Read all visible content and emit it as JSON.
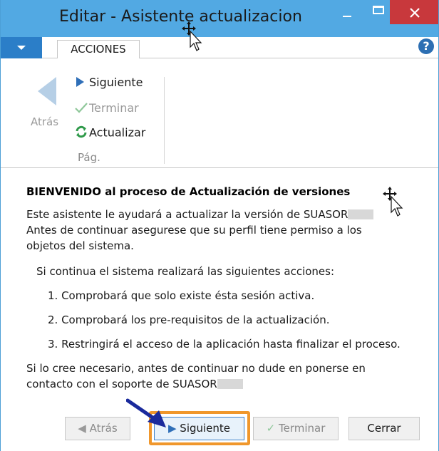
{
  "window": {
    "title": "Editar - Asistente actualizacion"
  },
  "ribbon": {
    "tab_label": "ACCIONES",
    "back_label": "Atrás",
    "next_label": "Siguiente",
    "finish_label": "Terminar",
    "refresh_label": "Actualizar",
    "group_label": "Pág."
  },
  "content": {
    "heading": "BIENVENIDO al proceso de Actualización de versiones",
    "intro_line1": "Este asistente le ayudará a actualizar la versión de SUASOR",
    "intro_line2": "Antes de continuar asegurese que su perfil tiene permiso a los",
    "intro_line3": "objetos del sistema.",
    "actions_intro": "Si continua el sistema realizará las siguientes acciones:",
    "step1": "1. Comprobará que solo existe ésta sesión activa.",
    "step2": "2. Comprobará los pre-requisitos de la actualización.",
    "step3": "3. Restringirá el acceso de la aplicación hasta finalizar el proceso.",
    "contact_line1": "Si lo cree necesario, antes de continuar no dude en ponerse en",
    "contact_line2": "contacto con el soporte de SUASOR"
  },
  "buttons": {
    "back": "Atrás",
    "next": "Siguiente",
    "finish": "Terminar",
    "close": "Cerrar"
  },
  "colors": {
    "titlebar": "#52a9e3",
    "close_button": "#c8383c",
    "highlight": "#f0972c",
    "annotation_arrow": "#1a2a9c"
  }
}
